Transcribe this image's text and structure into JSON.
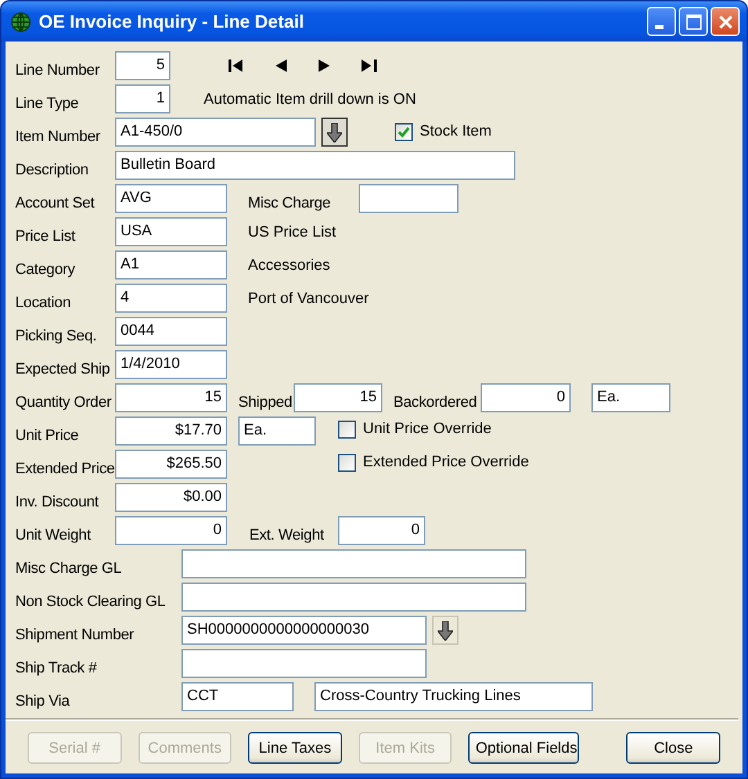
{
  "window": {
    "title": "OE Invoice Inquiry - Line Detail"
  },
  "line_number": {
    "label": "Line Number",
    "value": "5"
  },
  "line_type": {
    "label": "Line Type",
    "value": "1"
  },
  "drill_down_note": "Automatic Item drill down is ON",
  "item_number": {
    "label": "Item Number",
    "value": "A1-450/0"
  },
  "stock_item": {
    "label": "Stock Item",
    "checked": true
  },
  "description": {
    "label": "Description",
    "value": "Bulletin Board"
  },
  "account_set": {
    "label": "Account Set",
    "value": "AVG"
  },
  "misc_charge": {
    "label": "Misc Charge"
  },
  "price_list": {
    "label": "Price List",
    "value": "USA",
    "name": "US Price List"
  },
  "category": {
    "label": "Category",
    "value": "A1",
    "name": "Accessories"
  },
  "location": {
    "label": "Location",
    "value": "4",
    "name": "Port of Vancouver"
  },
  "picking_seq": {
    "label": "Picking Seq.",
    "value": "0044"
  },
  "expected_ship": {
    "label": "Expected Ship",
    "value": "1/4/2010"
  },
  "quantity_order": {
    "label": "Quantity Order",
    "value": "15"
  },
  "shipped": {
    "label": "Shipped",
    "value": "15"
  },
  "backordered": {
    "label": "Backordered",
    "value": "0"
  },
  "quantity_uom": "Ea.",
  "unit_price": {
    "label": "Unit Price",
    "value": "$17.70",
    "uom": "Ea."
  },
  "unit_price_override": {
    "label": "Unit Price Override",
    "checked": false
  },
  "extended_price": {
    "label": "Extended Price",
    "value": "$265.50"
  },
  "extended_price_override": {
    "label": "Extended Price Override",
    "checked": false
  },
  "inv_discount": {
    "label": "Inv. Discount",
    "value": "$0.00"
  },
  "unit_weight": {
    "label": "Unit Weight",
    "value": "0"
  },
  "ext_weight": {
    "label": "Ext. Weight",
    "value": "0"
  },
  "misc_charge_gl": {
    "label": "Misc Charge GL"
  },
  "non_stock_clearing_gl": {
    "label": "Non Stock Clearing GL"
  },
  "shipment_number": {
    "label": "Shipment Number",
    "value": "SH0000000000000000030"
  },
  "ship_track": {
    "label": "Ship Track #"
  },
  "ship_via": {
    "label": "Ship Via",
    "value": "CCT",
    "name": "Cross-Country Trucking Lines"
  },
  "buttons": [
    {
      "label": "Serial #",
      "disabled": true
    },
    {
      "label": "Comments",
      "disabled": true
    },
    {
      "label": "Line Taxes",
      "disabled": false
    },
    {
      "label": "Item Kits",
      "disabled": true
    },
    {
      "label": "Optional Fields",
      "disabled": false
    },
    {
      "label": "Close",
      "disabled": false
    }
  ]
}
